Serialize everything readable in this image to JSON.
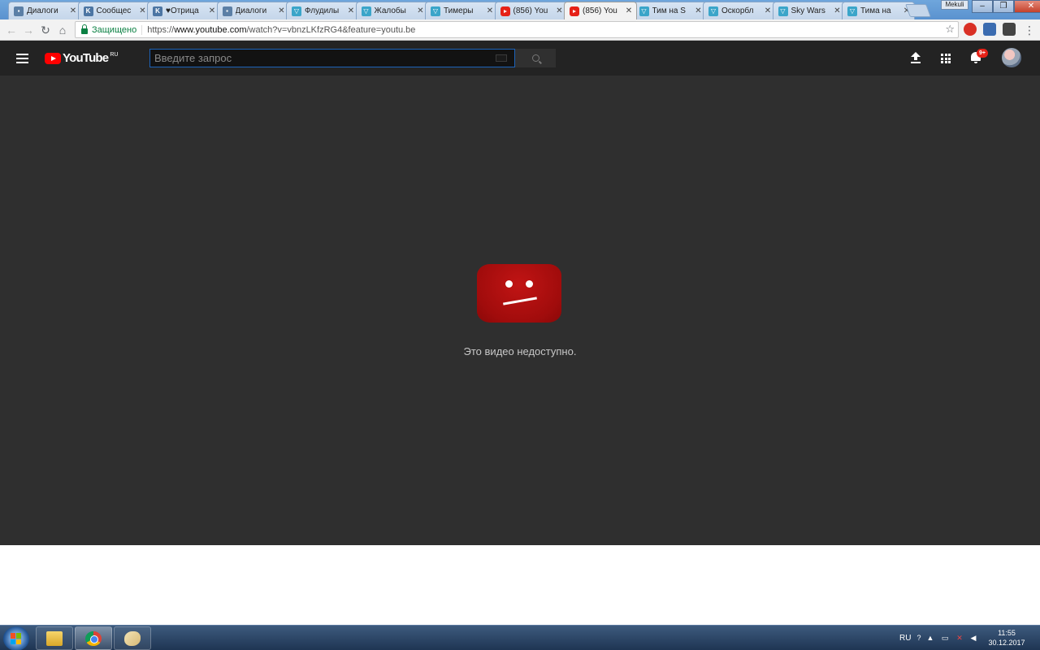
{
  "browser": {
    "tabs": [
      {
        "title": "Диалоги",
        "icon": "vk-message-icon"
      },
      {
        "title": "Сообщес",
        "icon": "vk-icon"
      },
      {
        "title": "♥Отрица",
        "icon": "vk-icon"
      },
      {
        "title": "Диалоги",
        "icon": "vk-message-icon"
      },
      {
        "title": "Флудилы",
        "icon": "shield-icon"
      },
      {
        "title": "Жалобы",
        "icon": "shield-icon"
      },
      {
        "title": "Тимеры",
        "icon": "shield-icon"
      },
      {
        "title": "(856) You",
        "icon": "youtube-icon"
      },
      {
        "title": "(856) You",
        "icon": "youtube-icon"
      },
      {
        "title": "Тим на S",
        "icon": "shield-icon"
      },
      {
        "title": "Оскорбл",
        "icon": "shield-icon"
      },
      {
        "title": "Sky Wars",
        "icon": "shield-icon"
      },
      {
        "title": "Тима на",
        "icon": "shield-icon"
      }
    ],
    "active_tab_index": 8,
    "window_user": "Mekuli",
    "secure_label": "Защищено",
    "url_scheme": "https://",
    "url_host": "www.youtube.com",
    "url_path": "/watch?v=vbnzLKfzRG4&feature=youtu.be"
  },
  "youtube": {
    "logo_text": "YouTube",
    "region": "RU",
    "search_placeholder": "Введите запрос",
    "notification_badge": "9+",
    "error_message": "Это видео недоступно."
  },
  "taskbar": {
    "language": "RU",
    "time": "11:55",
    "date": "30.12.2017"
  },
  "colors": {
    "masthead_bg": "#232323",
    "player_bg": "#2f2f2f",
    "yt_red": "#ff0000",
    "sad_tv_red": "#a10c0c",
    "search_border": "#1c62b9"
  }
}
